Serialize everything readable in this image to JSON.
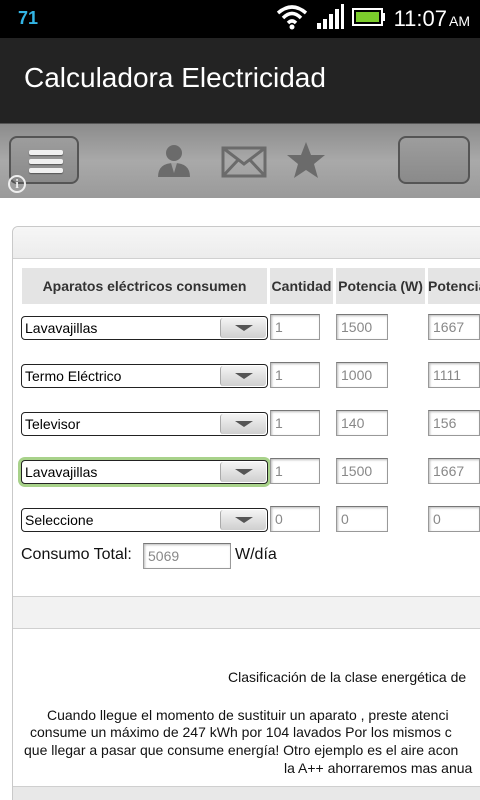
{
  "status_bar": {
    "notification_count": "71",
    "time": "11:07",
    "ampm": "AM",
    "icons": [
      "wifi-icon",
      "signal-icon",
      "battery-icon"
    ],
    "accent_color": "#33b5e5"
  },
  "app": {
    "title": "Calculadora Electricidad"
  },
  "toolbar": {
    "icons": [
      "menu-icon",
      "info-icon",
      "contact-icon",
      "mail-icon",
      "star-icon"
    ]
  },
  "table": {
    "headers": [
      "Aparatos eléctricos consumen",
      "Cantidad",
      "Potencia (W)",
      "Potencia"
    ],
    "rows": [
      {
        "appliance": "Lavavajillas",
        "cantidad": "1",
        "potencia": "1500",
        "potencia2": "1667",
        "focused": false
      },
      {
        "appliance": "Termo Eléctrico",
        "cantidad": "1",
        "potencia": "1000",
        "potencia2": "1111",
        "focused": false
      },
      {
        "appliance": "Televisor",
        "cantidad": "1",
        "potencia": "140",
        "potencia2": "156",
        "focused": false
      },
      {
        "appliance": "Lavavajillas",
        "cantidad": "1",
        "potencia": "1500",
        "potencia2": "1667",
        "focused": true
      },
      {
        "appliance": "Seleccione",
        "cantidad": "0",
        "potencia": "0",
        "potencia2": "0",
        "focused": false
      }
    ]
  },
  "total": {
    "label": "Consumo Total:",
    "value": "5069",
    "unit": "W/día"
  },
  "info": {
    "heading": "Clasificación de la clase energética de",
    "paragraph": [
      "Cuando llegue el momento de sustituir un aparato , preste atenci",
      "consume un máximo de 247 kWh por 104 lavados Por los mismos c",
      "que llegar a pasar que consume energía! Otro ejemplo es el aire acon",
      "la A++ ahorraremos mas anua"
    ]
  }
}
